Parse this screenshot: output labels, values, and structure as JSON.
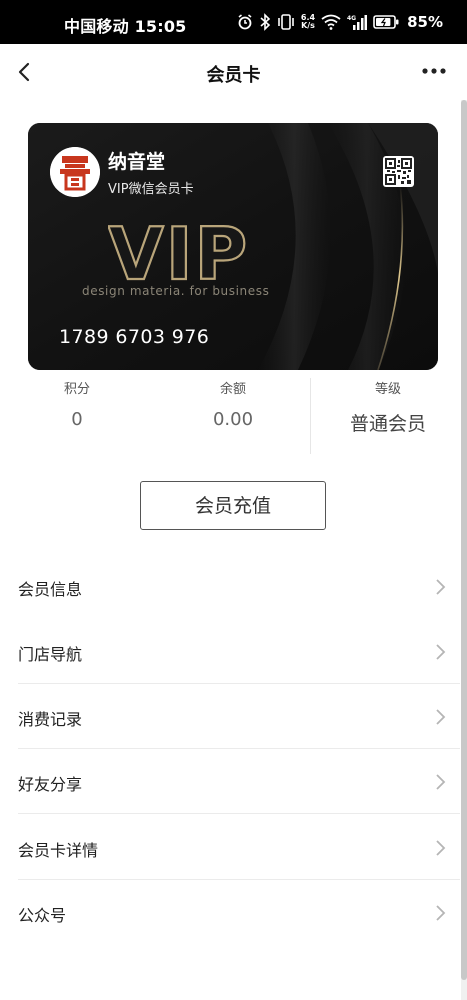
{
  "status_bar": {
    "carrier_time": "中国移动 15:05",
    "net_speed_value": "6.4",
    "net_speed_unit": "K/s",
    "signal_type": "4G",
    "battery_level": 0.85,
    "battery_percent": "85%"
  },
  "nav": {
    "title": "会员卡"
  },
  "card": {
    "brand_name": "纳音堂",
    "card_type": "VIP微信会员卡",
    "vip_text": "VIP",
    "tagline": "design materia. for business",
    "card_number": "1789 6703 976"
  },
  "stats": {
    "points_label": "积分",
    "points_value": "0",
    "balance_label": "余额",
    "balance_value": "0.00",
    "level_label": "等级",
    "level_value": "普通会员"
  },
  "recharge_button": "会员充值",
  "menu": [
    {
      "label": "会员信息"
    },
    {
      "label": "门店导航"
    },
    {
      "label": "消费记录"
    },
    {
      "label": "好友分享"
    },
    {
      "label": "会员卡详情"
    },
    {
      "label": "公众号"
    }
  ],
  "colors": {
    "card_background": "#151515",
    "card_gold": "#b9a57a",
    "logo_red": "#c8361d"
  }
}
